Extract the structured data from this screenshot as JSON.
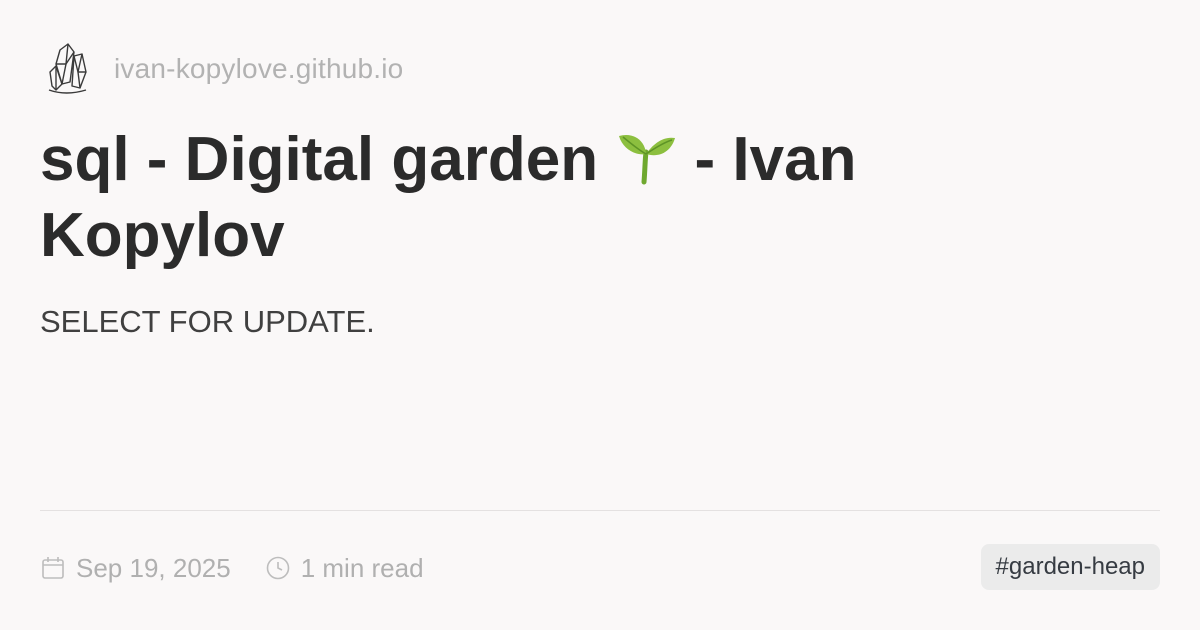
{
  "site": {
    "logo_icon": "crystal-icon",
    "domain": "ivan-kopylove.github.io"
  },
  "post": {
    "title_before_emoji": "sql - Digital garden ",
    "emoji_icon": "seedling-icon",
    "title_after_emoji": " - Ivan Kopylov",
    "description": "SELECT FOR UPDATE.",
    "date": "Sep 19, 2025",
    "date_icon": "calendar-icon",
    "read_time": "1 min read",
    "read_time_icon": "clock-icon",
    "tag": "#garden-heap"
  },
  "colors": {
    "background": "#faf8f8",
    "title": "#2b2b2b",
    "muted": "#b0b0b0",
    "tag_background": "#ebebeb",
    "sprout_green": "#8cbf3f"
  }
}
